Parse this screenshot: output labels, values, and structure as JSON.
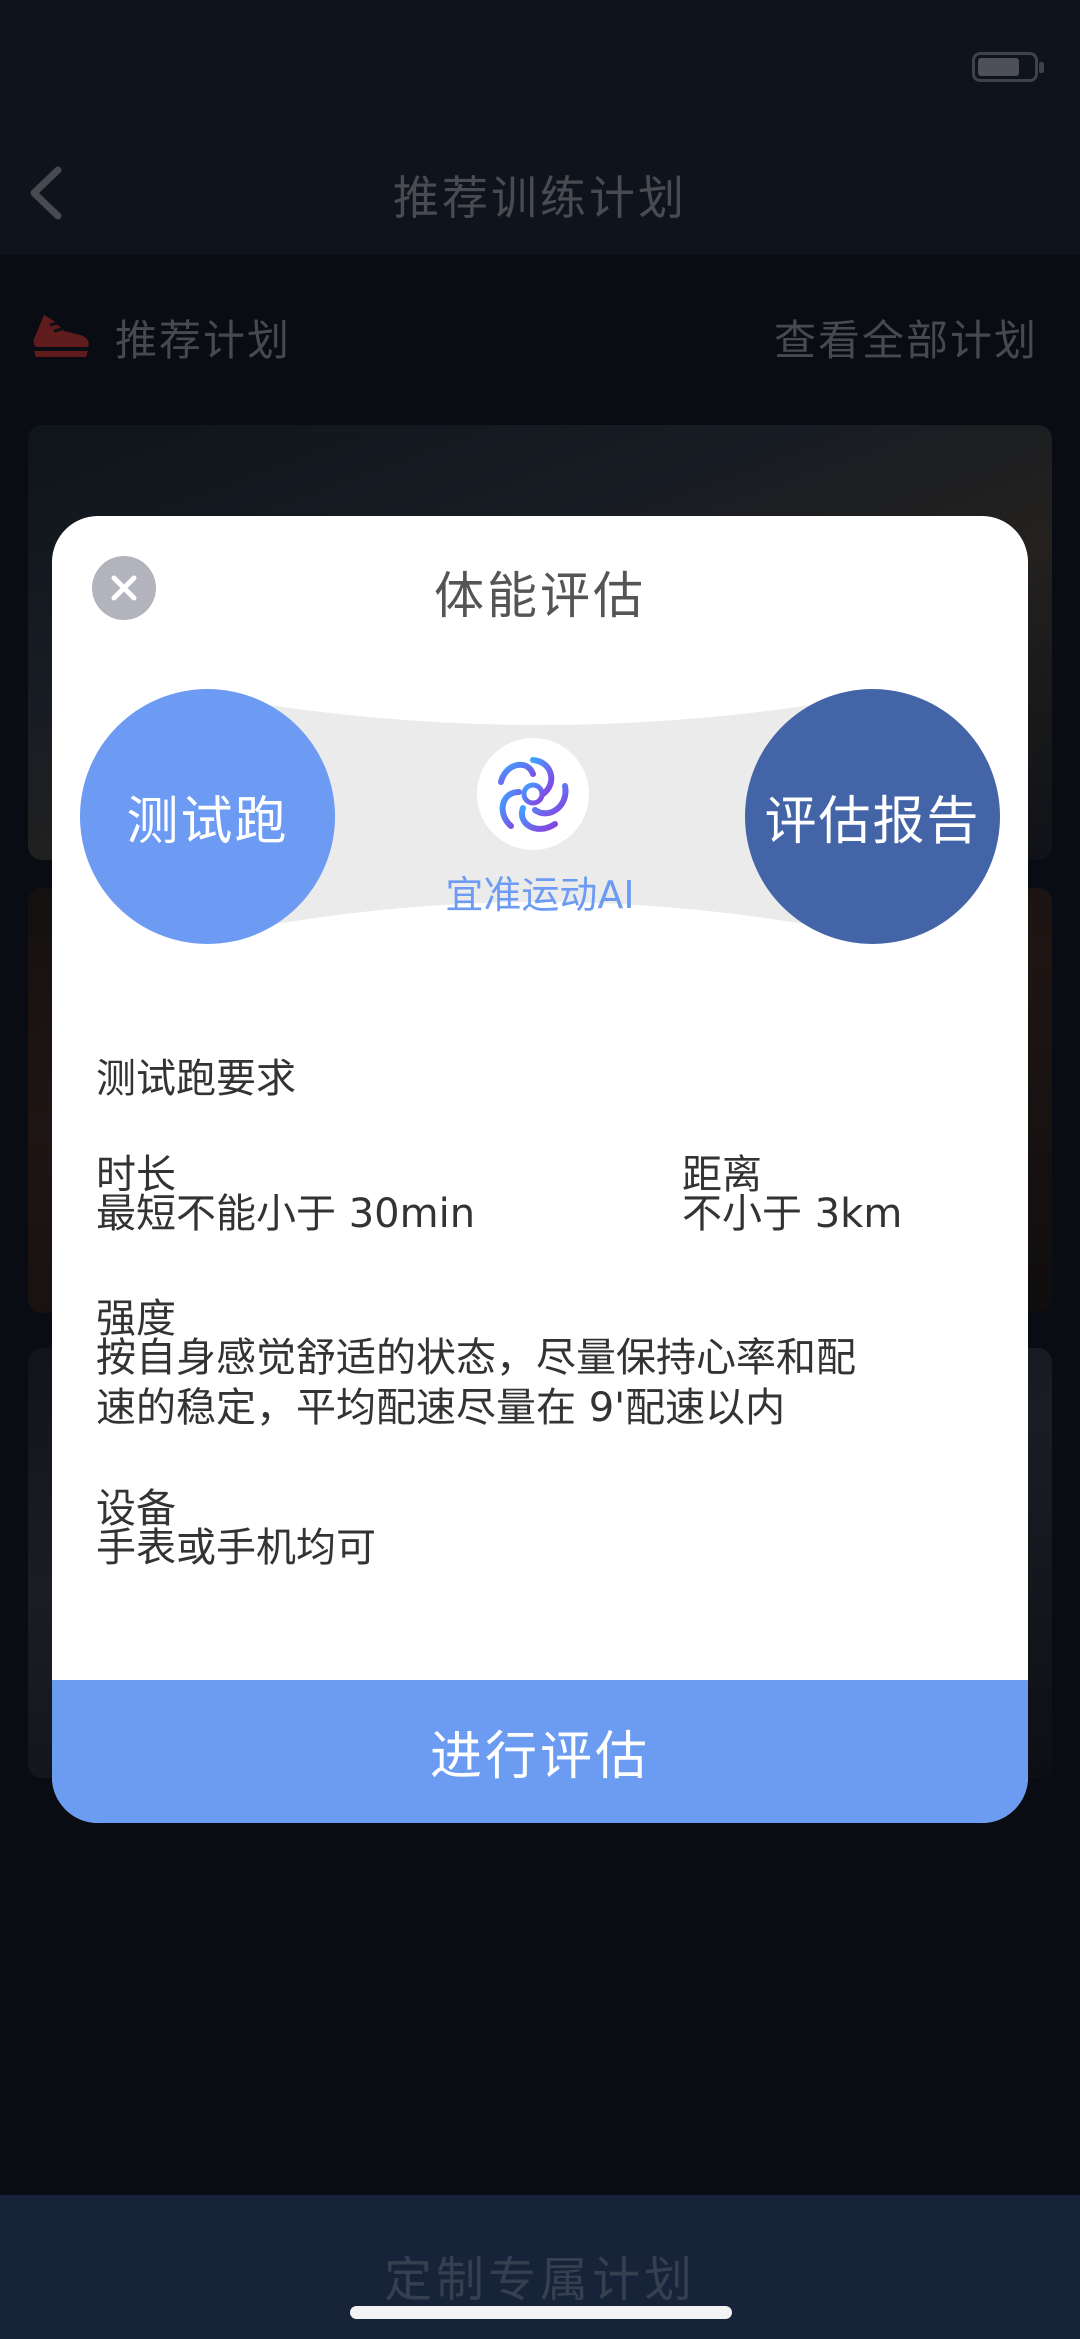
{
  "nav": {
    "title": "推荐训练计划",
    "back_icon": "chevron-left-icon"
  },
  "section": {
    "title": "推荐计划",
    "view_all": "查看全部计划",
    "icon": "running-shoe-icon"
  },
  "bottom": {
    "label": "定制专属计划"
  },
  "modal": {
    "title": "体能评估",
    "close_icon": "close-icon",
    "flow": {
      "left": "测试跑",
      "right": "评估报告",
      "ai_label": "宜准运动AI",
      "ai_icon": "ai-spiral-logo-icon"
    },
    "requirements_title": "测试跑要求",
    "duration": {
      "label": "时长",
      "value": "最短不能小于 30min"
    },
    "distance": {
      "label": "距离",
      "value": "不小于 3km"
    },
    "intensity": {
      "label": "强度",
      "line1": "按自身感觉舒适的状态，尽量保持心率和配",
      "line2": "速的稳定，平均配速尽量在 9'配速以内"
    },
    "device": {
      "label": "设备",
      "value": "手表或手机均可"
    },
    "submit": "进行评估"
  },
  "colors": {
    "accent": "#6c9bf2",
    "report": "#4464a8",
    "brand_bar": "#2d4673",
    "shoe": "#c0393b"
  }
}
